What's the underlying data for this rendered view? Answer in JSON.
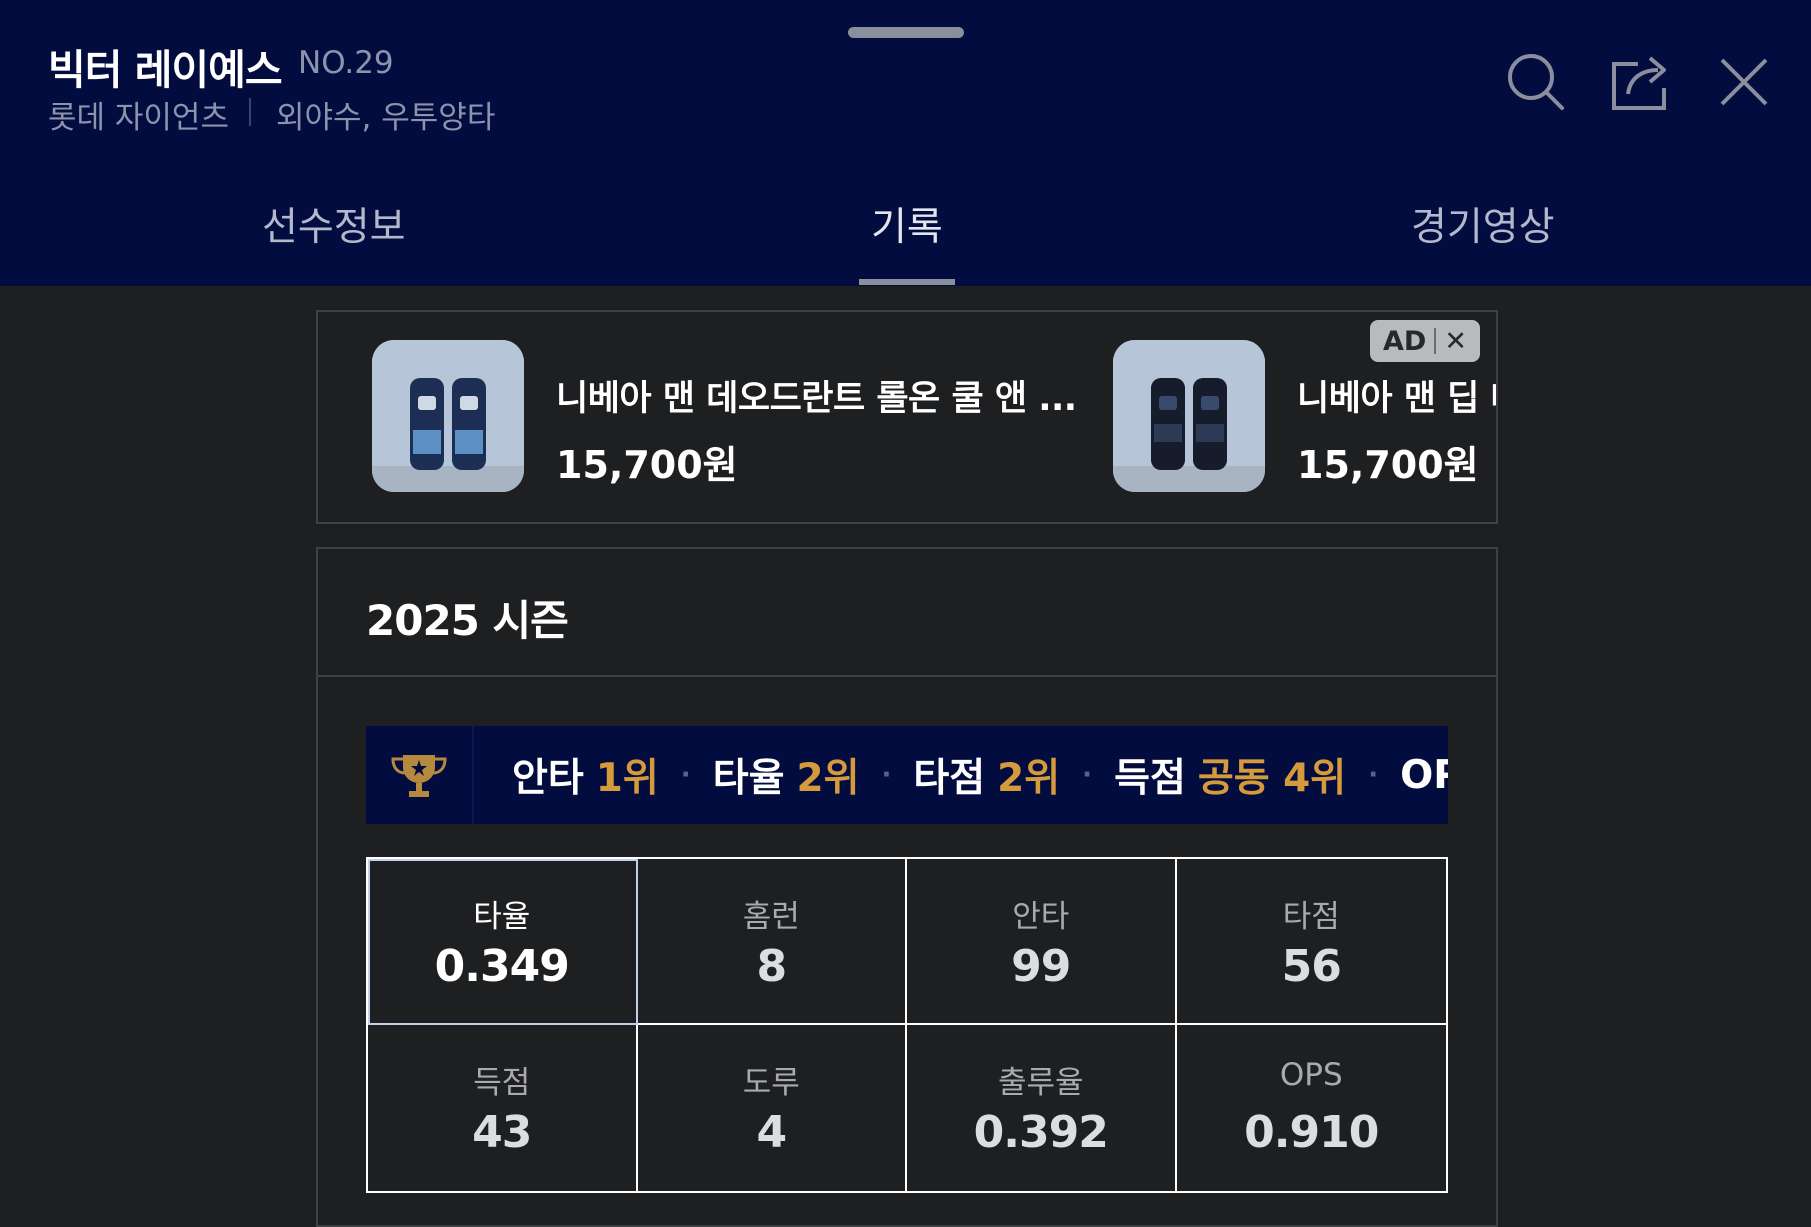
{
  "header": {
    "player_name": "빅터 레이예스",
    "player_number": "NO.29",
    "team": "롯데 자이언츠",
    "position": "외야수, 우투양타",
    "icons": [
      "search-icon",
      "share-icon",
      "close-icon"
    ]
  },
  "tabs": [
    {
      "label": "선수정보",
      "active": false
    },
    {
      "label": "기록",
      "active": true
    },
    {
      "label": "경기영상",
      "active": false
    }
  ],
  "ad": {
    "badge": "AD",
    "close_glyph": "✕",
    "items": [
      {
        "title": "니베아 맨 데오드란트 롤온 쿨 앤 ...",
        "price": "15,700원"
      },
      {
        "title": "니베아 맨 딥 데오드란트 롤온",
        "price": "15,700원"
      }
    ]
  },
  "season": {
    "title": "2025 시즌",
    "rankings": [
      {
        "label": "안타",
        "value": "1위"
      },
      {
        "label": "타율",
        "value": "2위"
      },
      {
        "label": "타점",
        "value": "2위"
      },
      {
        "label": "득점",
        "value": "공동 4위"
      },
      {
        "label": "OPS",
        "value": ""
      }
    ],
    "stats": [
      {
        "label": "타율",
        "value": "0.349",
        "highlight": true
      },
      {
        "label": "홈런",
        "value": "8",
        "highlight": false
      },
      {
        "label": "안타",
        "value": "99",
        "highlight": false
      },
      {
        "label": "타점",
        "value": "56",
        "highlight": false
      },
      {
        "label": "득점",
        "value": "43",
        "highlight": false
      },
      {
        "label": "도루",
        "value": "4",
        "highlight": false
      },
      {
        "label": "출루율",
        "value": "0.392",
        "highlight": false
      },
      {
        "label": "OPS",
        "value": "0.910",
        "highlight": false
      }
    ]
  },
  "colors": {
    "header_bg": "#030c3f",
    "page_bg": "#1e1f21",
    "rank_accent": "#d49a3c"
  }
}
